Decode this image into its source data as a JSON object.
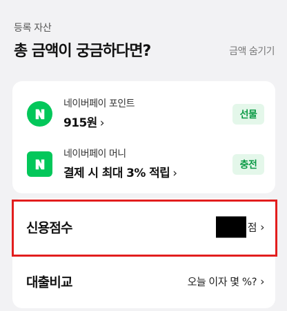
{
  "assets": {
    "overline": "등록 자산",
    "headline": "총 금액이 궁금하다면?",
    "hide_label": "금액 숨기기"
  },
  "pay": {
    "point": {
      "label": "네이버페이 포인트",
      "value": "915원",
      "action": "선물",
      "icon": "naver-n-icon"
    },
    "money": {
      "label": "네이버페이 머니",
      "value": "결제 시 최대 3% 적립",
      "action": "충전",
      "icon": "naver-n-icon"
    }
  },
  "list": {
    "credit": {
      "title": "신용점수",
      "unit": "점"
    },
    "loan": {
      "title": "대출비교",
      "detail": "오늘 이자 몇 %?"
    }
  },
  "chevron": "›",
  "colors": {
    "brand_green": "#03c75a",
    "pill_bg": "#e4f7ea",
    "pill_text": "#0a9a45",
    "highlight": "#e21d1d"
  }
}
